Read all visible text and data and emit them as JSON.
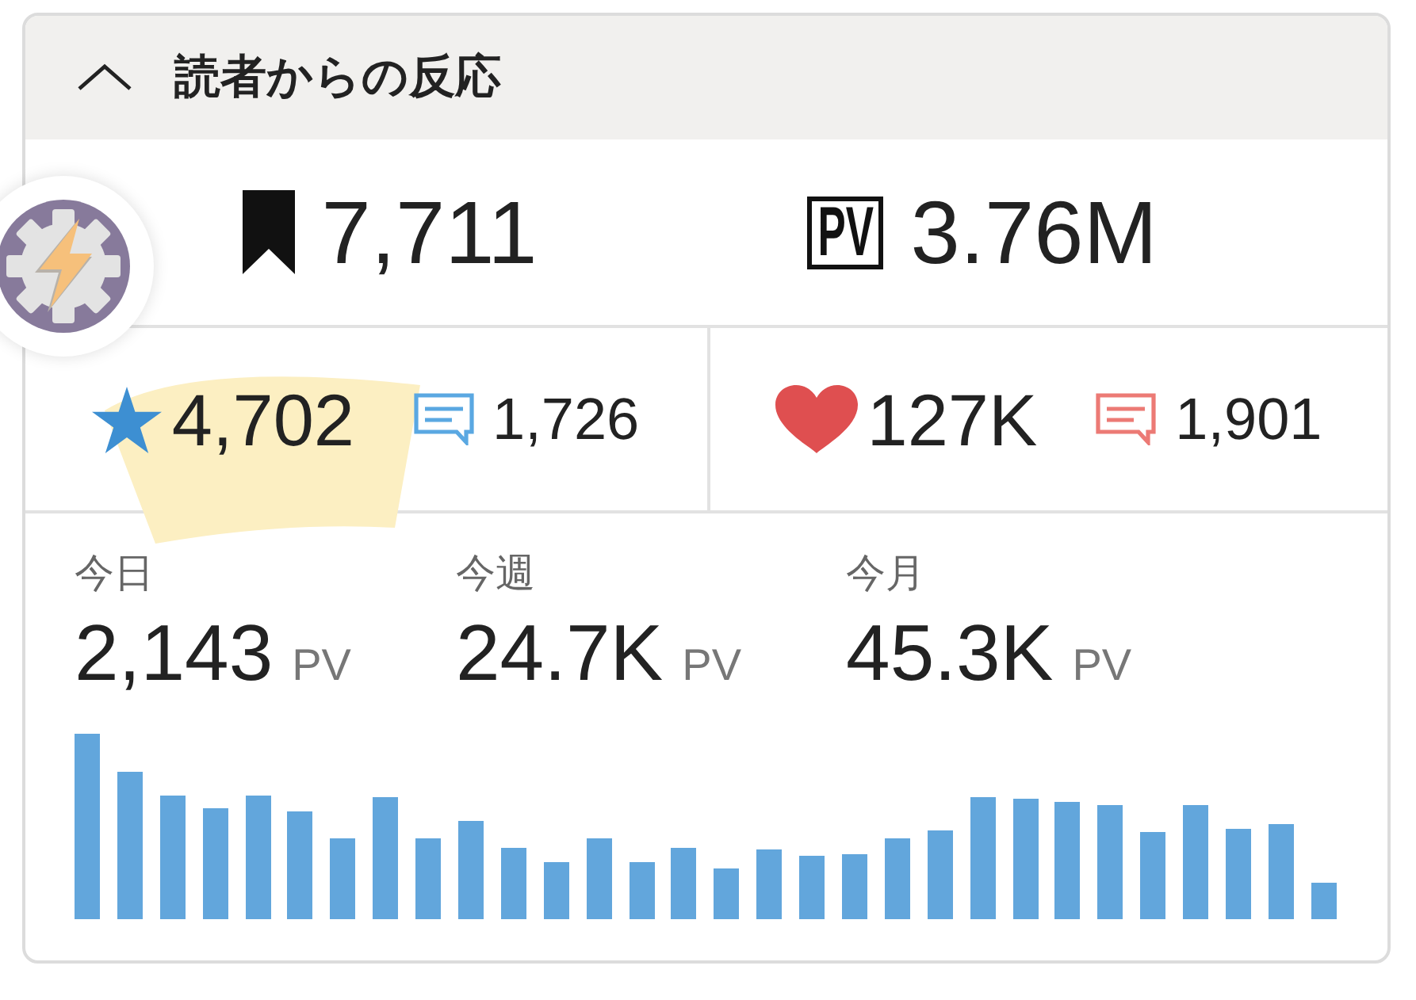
{
  "panel": {
    "title": "読者からの反応",
    "expanded": true
  },
  "totals": [
    {
      "kind": "bookmarks",
      "value": "7,711"
    },
    {
      "kind": "pageviews",
      "badge": "PV",
      "value": "3.76M"
    }
  ],
  "reactions": [
    {
      "kind": "stars",
      "count": "4,702",
      "comments": "1,726",
      "highlighted": true
    },
    {
      "kind": "likes",
      "count": "127K",
      "comments": "1,901",
      "highlighted": false
    }
  ],
  "periods": [
    {
      "label": "今日",
      "value": "2,143",
      "unit": "PV"
    },
    {
      "label": "今週",
      "value": "24.7K",
      "unit": "PV"
    },
    {
      "label": "今月",
      "value": "45.3K",
      "unit": "PV"
    }
  ]
}
